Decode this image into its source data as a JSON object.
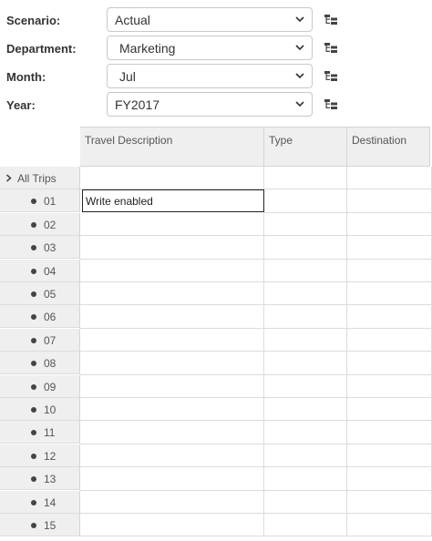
{
  "filters": [
    {
      "label": "Scenario:",
      "value": "Actual"
    },
    {
      "label": "Department:",
      "value": "Marketing"
    },
    {
      "label": "Month:",
      "value": "Jul"
    },
    {
      "label": "Year:",
      "value": "FY2017"
    }
  ],
  "grid": {
    "columns": [
      "Travel Description",
      "Type",
      "Destination"
    ],
    "group_row": "All Trips",
    "rows": [
      "01",
      "02",
      "03",
      "04",
      "05",
      "06",
      "07",
      "08",
      "09",
      "10",
      "11",
      "12",
      "13",
      "14",
      "15"
    ],
    "active_cell_value": "Write enabled"
  },
  "icons": {
    "dropdown": "chevron-down-icon",
    "hierarchy": "hierarchy-icon",
    "expand": "caret-right-icon",
    "row_bullet": "bullet-icon"
  }
}
